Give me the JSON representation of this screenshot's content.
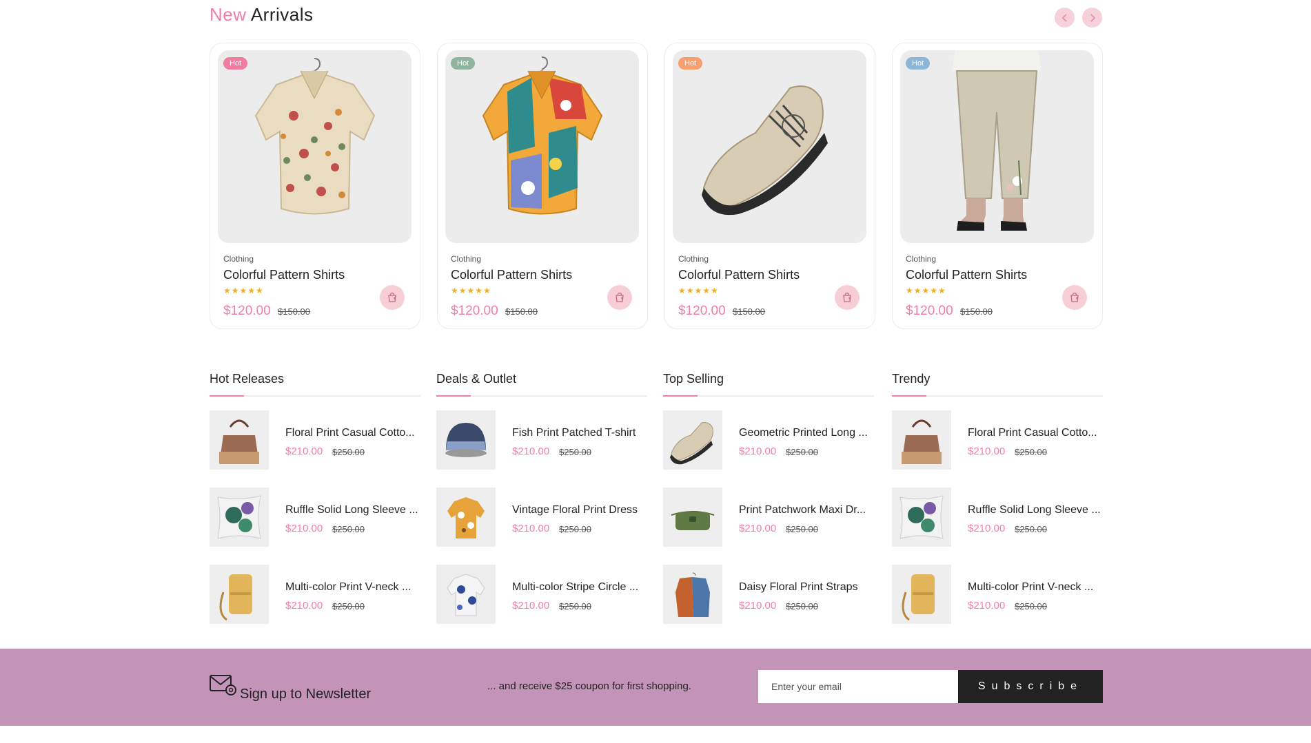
{
  "new_arrivals": {
    "title_accent": "New",
    "title_rest": "Arrivals",
    "prev_icon": "chevron-left-icon",
    "next_icon": "chevron-right-icon",
    "products": [
      {
        "badge": "Hot",
        "badge_color": "#f07ca0",
        "category": "Clothing",
        "name": "Colorful Pattern Shirts",
        "rating": 5,
        "stars": "★★★★★",
        "price": "$120.00",
        "old_price": "$150.00",
        "image": "mushroom-print-shirt"
      },
      {
        "badge": "Hot",
        "badge_color": "#8fb5a0",
        "category": "Clothing",
        "name": "Colorful Pattern Shirts",
        "rating": 5,
        "stars": "★★★★★",
        "price": "$120.00",
        "old_price": "$150.00",
        "image": "colorful-abstract-shirt"
      },
      {
        "badge": "Hot",
        "badge_color": "#f5a06e",
        "category": "Clothing",
        "name": "Colorful Pattern Shirts",
        "rating": 5,
        "stars": "★★★★★",
        "price": "$120.00",
        "old_price": "$150.00",
        "image": "beige-sneaker"
      },
      {
        "badge": "Hot",
        "badge_color": "#8cb6d8",
        "category": "Clothing",
        "name": "Colorful Pattern Shirts",
        "rating": 5,
        "stars": "★★★★★",
        "price": "$120.00",
        "old_price": "$150.00",
        "image": "linen-floral-pants"
      }
    ]
  },
  "lists": [
    {
      "title": "Hot Releases",
      "items": [
        {
          "name": "Floral Print Casual Cotton Dress",
          "display_name": "Floral Print Casual Cotto...",
          "price": "$210.00",
          "old_price": "$250.00",
          "image": "handbag"
        },
        {
          "name": "Ruffle Solid Long Sleeve",
          "display_name": "Ruffle Solid Long Sleeve ...",
          "price": "$210.00",
          "old_price": "$250.00",
          "image": "pillow"
        },
        {
          "name": "Multi-color Print V-neck",
          "display_name": "Multi-color Print V-neck ...",
          "price": "$210.00",
          "old_price": "$250.00",
          "image": "phone-bag"
        }
      ]
    },
    {
      "title": "Deals & Outlet",
      "items": [
        {
          "name": "Fish Print Patched T-shirt",
          "display_name": "Fish Print Patched T-shirt",
          "price": "$210.00",
          "old_price": "$250.00",
          "image": "beanie"
        },
        {
          "name": "Vintage Floral Print Dress",
          "display_name": "Vintage Floral Print Dress",
          "price": "$210.00",
          "old_price": "$250.00",
          "image": "floral-shirt"
        },
        {
          "name": "Multi-color Stripe Circle",
          "display_name": "Multi-color Stripe Circle ...",
          "price": "$210.00",
          "old_price": "$250.00",
          "image": "blue-white-shirt"
        }
      ]
    },
    {
      "title": "Top Selling",
      "items": [
        {
          "name": "Geometric Printed Long",
          "display_name": "Geometric Printed Long ...",
          "price": "$210.00",
          "old_price": "$250.00",
          "image": "sneaker"
        },
        {
          "name": "Print Patchwork Maxi Dress",
          "display_name": "Print Patchwork Maxi Dr...",
          "price": "$210.00",
          "old_price": "$250.00",
          "image": "green-bag"
        },
        {
          "name": "Daisy Floral Print Straps",
          "display_name": "Daisy Floral Print Straps",
          "price": "$210.00",
          "old_price": "$250.00",
          "image": "jackets"
        }
      ]
    },
    {
      "title": "Trendy",
      "items": [
        {
          "name": "Floral Print Casual Cotton Dress",
          "display_name": "Floral Print Casual Cotto...",
          "price": "$210.00",
          "old_price": "$250.00",
          "image": "handbag"
        },
        {
          "name": "Ruffle Solid Long Sleeve",
          "display_name": "Ruffle Solid Long Sleeve ...",
          "price": "$210.00",
          "old_price": "$250.00",
          "image": "pillow"
        },
        {
          "name": "Multi-color Print V-neck",
          "display_name": "Multi-color Print V-neck ...",
          "price": "$210.00",
          "old_price": "$250.00",
          "image": "phone-bag"
        }
      ]
    }
  ],
  "newsletter": {
    "icon": "mail-icon",
    "title": "Sign up to Newsletter",
    "note": "... and receive $25 coupon for first shopping.",
    "placeholder": "Enter your email",
    "button": "Subscribe",
    "background": "#c394b7"
  },
  "colors": {
    "accent": "#ef7fa3",
    "star": "#f2b01e",
    "cart_bg": "#f7cdd6"
  }
}
